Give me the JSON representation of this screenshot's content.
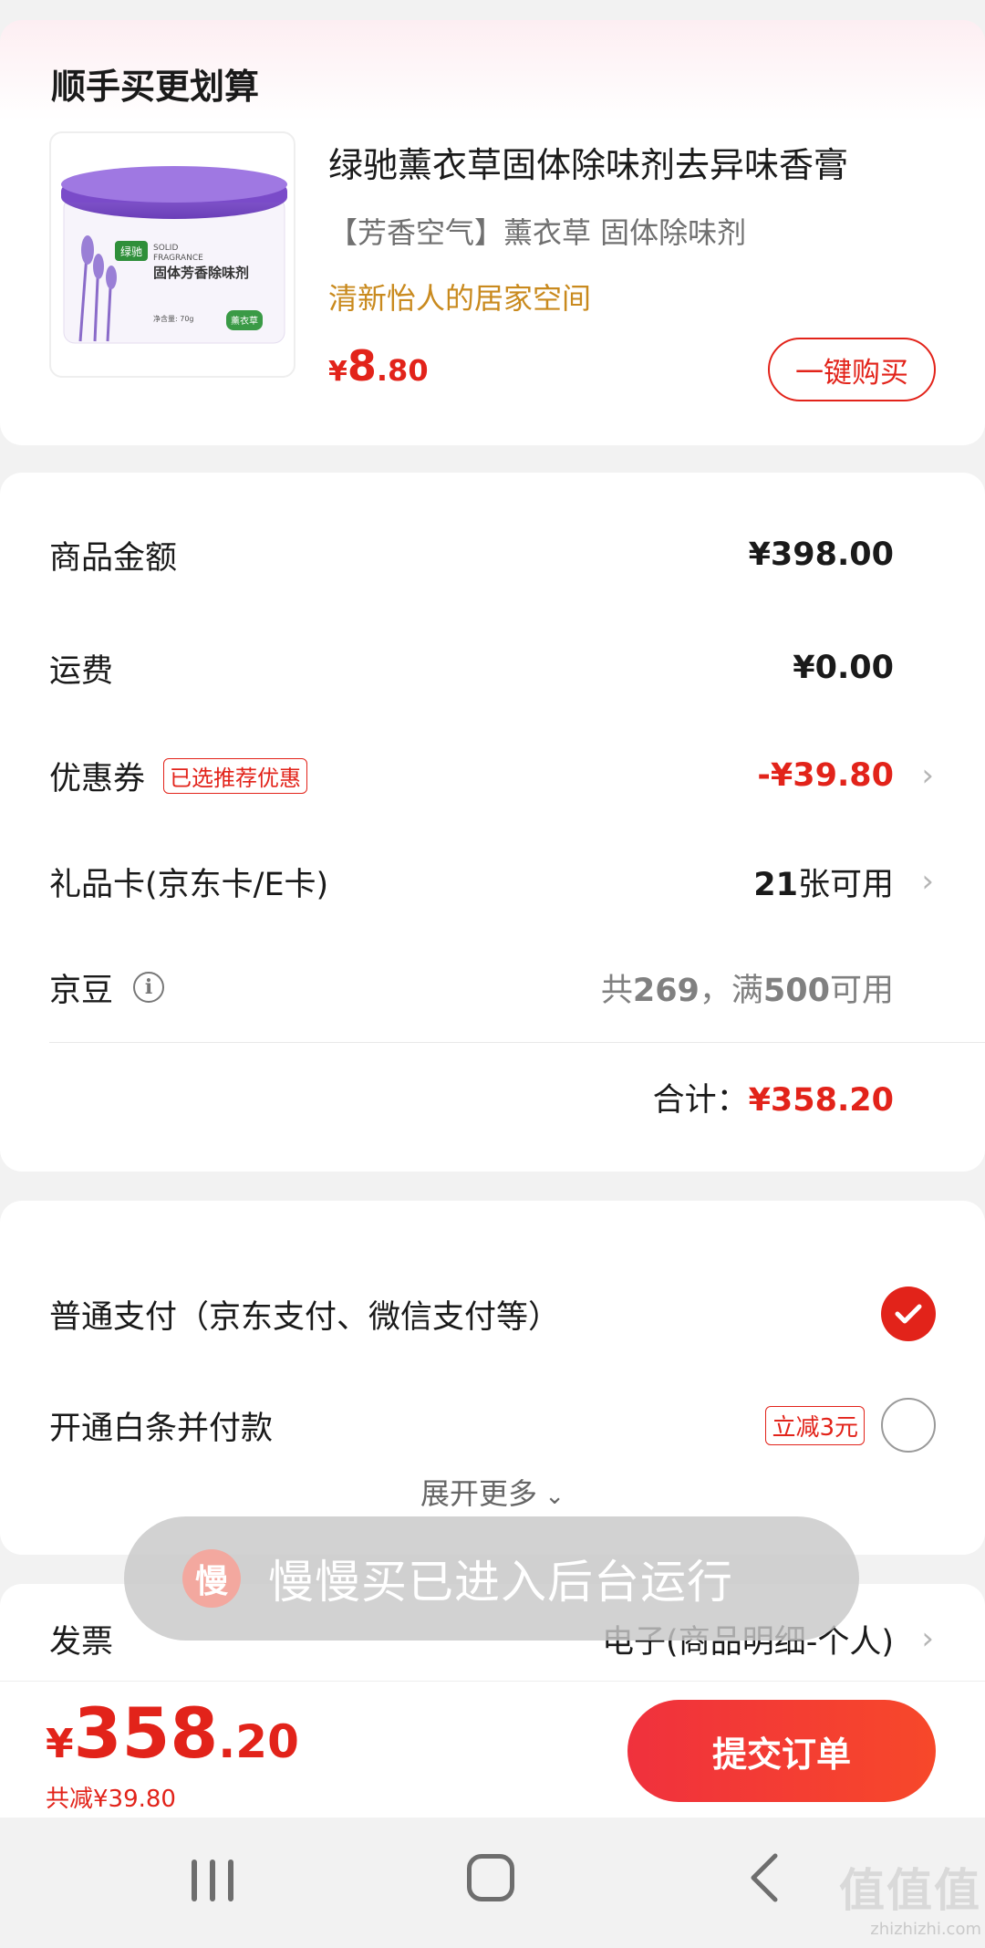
{
  "upsell": {
    "title": "顺手买更划算",
    "product": {
      "name": "绿驰薰衣草固体除味剂去异味香膏",
      "subtitle": "【芳香空气】薰衣草 固体除味剂",
      "slogan": "清新怡人的居家空间",
      "price_symbol": "¥",
      "price_int": "8",
      "price_dec": ".80",
      "buy_label": "一键购买",
      "image_brand": "绿驰",
      "image_en_1": "SOLID",
      "image_en_2": "FRAGRANCE",
      "image_title": "固体芳香除味剂",
      "image_weight": "净含量: 70g",
      "image_badge": "薰衣草"
    }
  },
  "amounts": {
    "goods_label": "商品金额",
    "goods_value": "¥398.00",
    "shipping_label": "运费",
    "shipping_value": "¥0.00",
    "coupon_label": "优惠券",
    "coupon_tag": "已选推荐优惠",
    "coupon_value": "-¥39.80",
    "giftcard_label": "礼品卡(京东卡/E卡)",
    "giftcard_count": "21",
    "giftcard_suffix": "张可用",
    "beans_label": "京豆",
    "beans_prefix": "共",
    "beans_count": "269",
    "beans_mid": "，满",
    "beans_threshold": "500",
    "beans_suffix": "可用",
    "total_label": "合计：",
    "total_value": "¥358.20"
  },
  "payment": {
    "normal_label": "普通支付（京东支付、微信支付等）",
    "baitiao_label": "开通白条并付款",
    "baitiao_tag": "立减3元",
    "expand_label": "展开更多"
  },
  "invoice": {
    "label": "发票",
    "value": "电子(商品明细-个人)"
  },
  "toast": {
    "icon_char": "慢",
    "text": "慢慢买已进入后台运行"
  },
  "bottom_bar": {
    "symbol": "¥",
    "total_int": "358",
    "total_dec": ".20",
    "saved_text": "共减¥39.80",
    "submit_label": "提交订单"
  },
  "watermark": {
    "glyphs": "值值值",
    "url": "zhizhizhi.com"
  },
  "colors": {
    "accent_red": "#e2231a",
    "slogan_gold": "#c98a1e",
    "lavender": "#7b4fc4"
  }
}
